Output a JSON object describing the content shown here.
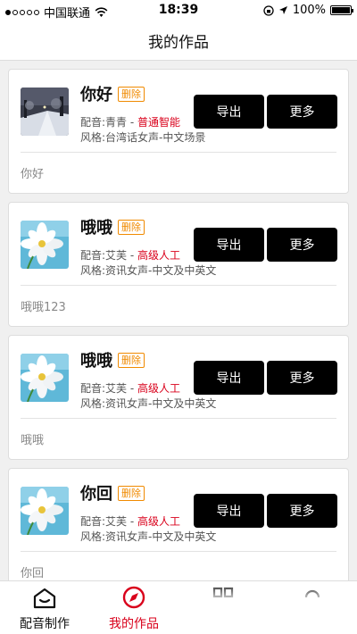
{
  "status_bar": {
    "carrier": "中国联通",
    "time": "18:39",
    "battery": "100%",
    "signal_icon": "signal-dots-icon",
    "wifi_icon": "wifi-icon"
  },
  "nav": {
    "title": "我的作品"
  },
  "labels": {
    "delete": "删除",
    "export": "导出",
    "more": "更多"
  },
  "works": [
    {
      "title": "你好",
      "voice_prefix": "配音:青青 - ",
      "tier": "普通智能",
      "style": "风格:台湾话女声-中文场景",
      "text": "你好",
      "thumb": "snow-street-image"
    },
    {
      "title": "哦哦",
      "voice_prefix": "配音:艾芙 - ",
      "tier": "高级人工",
      "style": "风格:资讯女声-中文及中英文",
      "text": "哦哦123",
      "thumb": "white-flower-image"
    },
    {
      "title": "哦哦",
      "voice_prefix": "配音:艾芙 - ",
      "tier": "高级人工",
      "style": "风格:资讯女声-中文及中英文",
      "text": "哦哦",
      "thumb": "white-flower-image"
    },
    {
      "title": "你回",
      "voice_prefix": "配音:艾芙 - ",
      "tier": "高级人工",
      "style": "风格:资讯女声-中文及中英文",
      "text": "你回",
      "thumb": "white-flower-image"
    }
  ],
  "tabs": [
    {
      "label": "配音制作",
      "icon": "house-icon",
      "active": false
    },
    {
      "label": "我的作品",
      "icon": "compass-icon",
      "active": true
    },
    {
      "label": "",
      "icon": "book-icon",
      "active": false
    },
    {
      "label": "",
      "icon": "user-icon",
      "active": false
    }
  ],
  "colors": {
    "accent": "#d9001b",
    "badge": "#f08a00",
    "button": "#000000"
  }
}
